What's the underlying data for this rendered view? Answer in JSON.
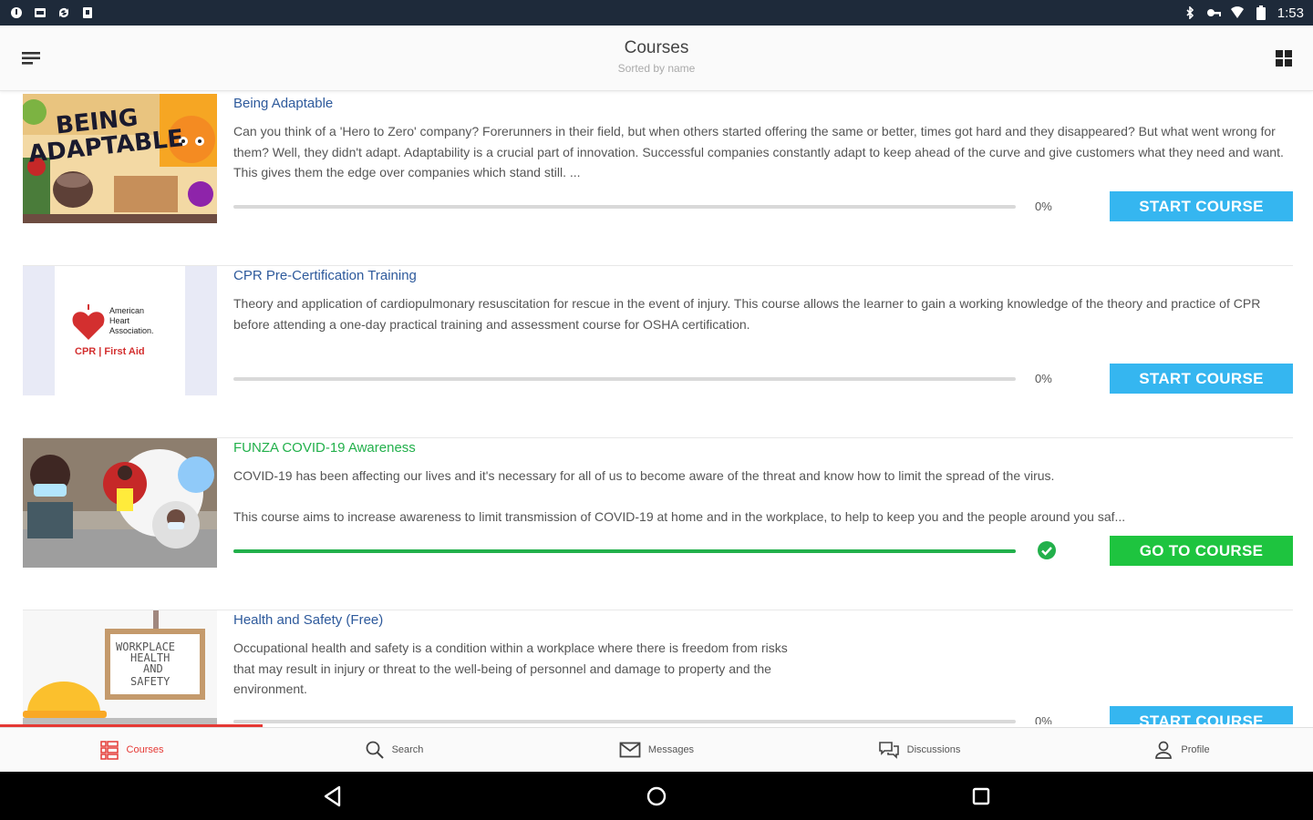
{
  "status_bar": {
    "time": "1:53"
  },
  "header": {
    "title": "Courses",
    "subtitle": "Sorted by name"
  },
  "courses": [
    {
      "title": "Being Adaptable",
      "thumb_text": [
        "BEING",
        "ADAPTABLE"
      ],
      "description": [
        "Can you think of a 'Hero to Zero' company? Forerunners in their field, but when others started offering the same or better, times got hard and they disappeared? But what went wrong for them? Well, they didn't adapt. Adaptability is a crucial part of innovation. Successful companies constantly adapt to keep ahead of the curve and give customers what they need and want. This gives them the edge over companies which stand still. ..."
      ],
      "progress": 0,
      "progress_label": "0%",
      "button_label": "START COURSE",
      "completed": false
    },
    {
      "title": "CPR Pre-Certification Training",
      "thumb_text": [
        "American",
        "Heart",
        "Association.",
        "CPR | First Aid"
      ],
      "description": [
        "Theory and application of cardiopulmonary resuscitation for rescue in the event of injury. This course allows the learner to gain a working knowledge of the theory and practice of CPR before attending a one-day practical training and assessment course for OSHA certification."
      ],
      "progress": 0,
      "progress_label": "0%",
      "button_label": "START COURSE",
      "completed": false
    },
    {
      "title": "FUNZA COVID-19 Awareness",
      "description": [
        "COVID-19 has been affecting our lives and it's necessary for all of us to become aware of the threat and know how to limit the spread of the virus.",
        "This course aims to increase awareness to limit transmission of COVID-19 at home and in the workplace, to help to keep you and the people around you saf..."
      ],
      "progress": 1,
      "progress_label": "",
      "button_label": "GO TO COURSE",
      "completed": true
    },
    {
      "title": "Health and Safety (Free)",
      "thumb_text": [
        "WORKPLACE",
        "HEALTH",
        "AND",
        "SAFETY"
      ],
      "description": [
        "Occupational health and safety is a condition within a workplace where there is freedom from risks that may result in injury or threat to the well-being of personnel and damage to property and the environment."
      ],
      "progress": 0,
      "progress_label": "0%",
      "button_label": "START COURSE",
      "completed": false
    }
  ],
  "bottom_nav": [
    {
      "label": "Courses",
      "icon": "courses-icon",
      "active": true
    },
    {
      "label": "Search",
      "icon": "search-icon",
      "active": false
    },
    {
      "label": "Messages",
      "icon": "mail-icon",
      "active": false
    },
    {
      "label": "Discussions",
      "icon": "chat-icon",
      "active": false
    },
    {
      "label": "Profile",
      "icon": "person-icon",
      "active": false
    }
  ],
  "loading_progress": 0.2,
  "colors": {
    "accent_blue": "#35b6f0",
    "accent_green": "#1ec43f",
    "title_blue": "#2e5a9c",
    "active_red": "#e53935"
  }
}
